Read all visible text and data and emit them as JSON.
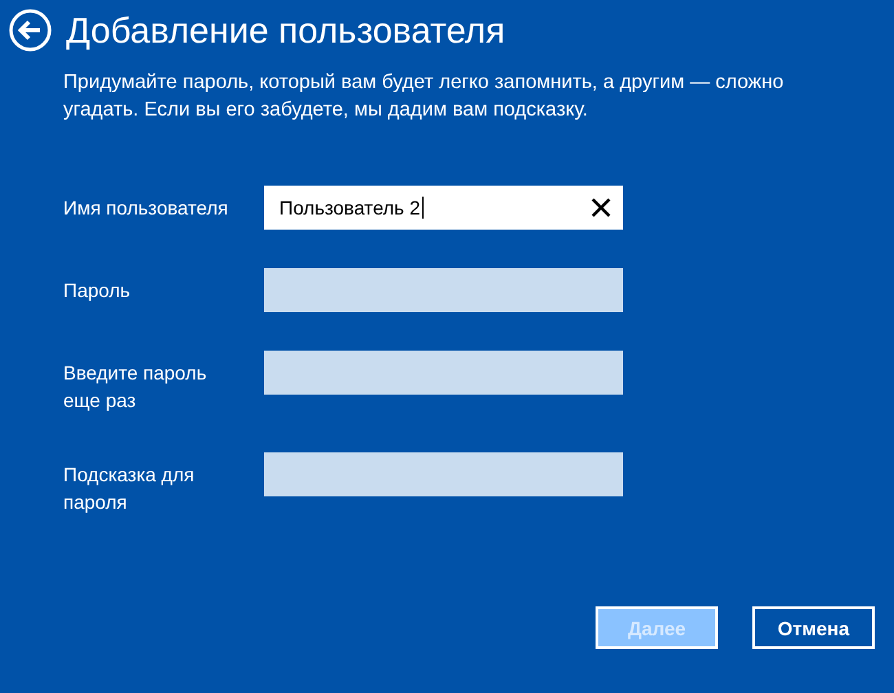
{
  "title": "Добавление пользователя",
  "description": "Придумайте пароль, который вам будет легко запомнить, а другим — сложно угадать. Если вы его забудете, мы дадим вам подсказку.",
  "fields": [
    {
      "label": "Имя пользователя",
      "value": "Пользователь 2",
      "focused": true
    },
    {
      "label": "Пароль",
      "focused": false
    },
    {
      "label": "Введите пароль\nеще раз",
      "focused": false
    },
    {
      "label": "Подсказка для\nпароля",
      "focused": false
    }
  ],
  "buttons": [
    {
      "label": "Далее",
      "disabled": true
    },
    {
      "label": "Отмена",
      "disabled": false
    }
  ]
}
